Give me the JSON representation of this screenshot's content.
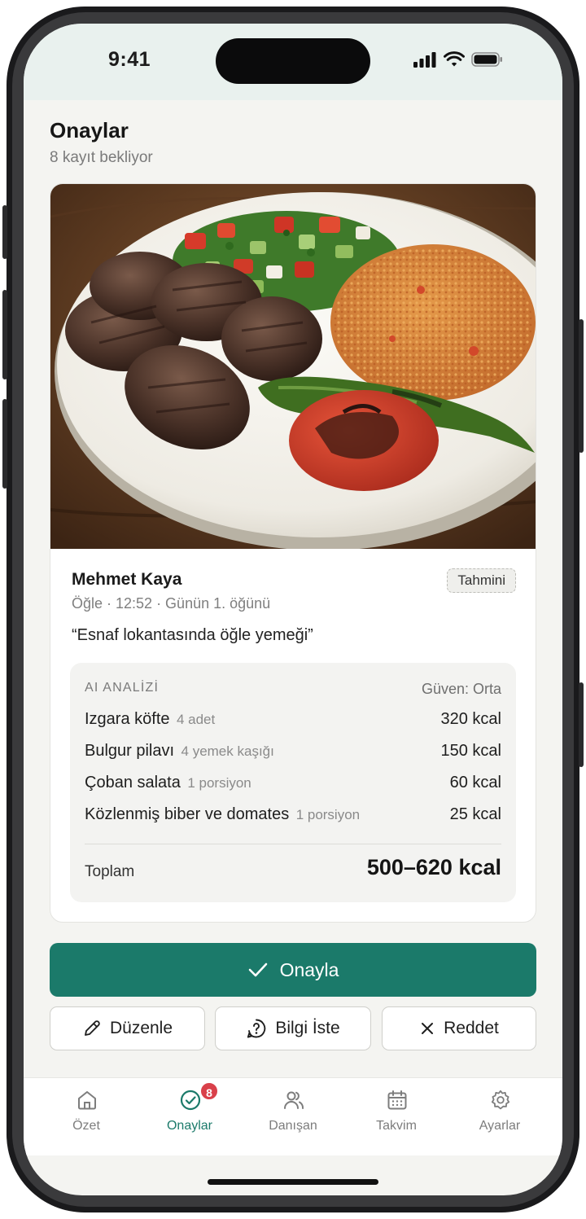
{
  "status_bar": {
    "time": "9:41"
  },
  "header": {
    "title": "Onaylar",
    "subtitle": "8 kayıt bekliyor"
  },
  "entry": {
    "client_name": "Mehmet Kaya",
    "meta": "Öğle · 12:52 · Günün 1. öğünü",
    "badge": "Tahmini",
    "note": "“Esnaf lokantasında öğle yemeği”",
    "photo_icon": "food-photo"
  },
  "analysis": {
    "title": "AI ANALİZİ",
    "confidence": "Güven: Orta",
    "items": [
      {
        "name": "Izgara köfte",
        "qty": "4 adet",
        "kcal": "320 kcal"
      },
      {
        "name": "Bulgur pilavı",
        "qty": "4 yemek kaşığı",
        "kcal": "150 kcal"
      },
      {
        "name": "Çoban salata",
        "qty": "1 porsiyon",
        "kcal": "60 kcal"
      },
      {
        "name": "Közlenmiş biber ve domates",
        "qty": "1 porsiyon",
        "kcal": "25 kcal"
      }
    ],
    "total_label": "Toplam",
    "total_value": "500–620 kcal"
  },
  "actions": {
    "approve": "Onayla",
    "edit": "Düzenle",
    "ask_info": "Bilgi İste",
    "reject": "Reddet"
  },
  "tabs": [
    {
      "label": "Özet",
      "icon": "home-icon"
    },
    {
      "label": "Onaylar",
      "icon": "check-circle-icon",
      "badge": "8",
      "active": true
    },
    {
      "label": "Danışan",
      "icon": "users-icon"
    },
    {
      "label": "Takvim",
      "icon": "calendar-icon"
    },
    {
      "label": "Ayarlar",
      "icon": "gear-icon"
    }
  ],
  "colors": {
    "accent": "#1b7a6a",
    "badge": "#d9404a",
    "background": "#f4f4f1"
  }
}
